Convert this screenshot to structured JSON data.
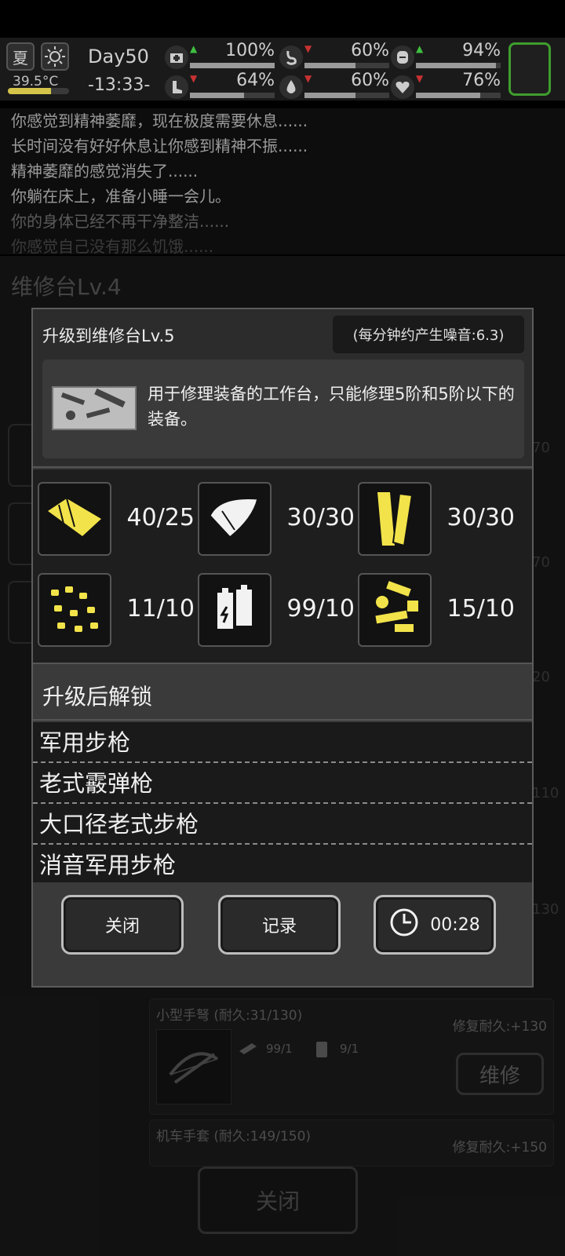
{
  "status": {
    "season_label": "夏",
    "temperature": "39.5°C",
    "temperature_level": 0.7,
    "day": "Day50",
    "time": "-13:33-",
    "stats": [
      {
        "name": "health",
        "icon": "medkit-icon",
        "value": "100%",
        "trend": "up",
        "level": 1.0
      },
      {
        "name": "stomach",
        "icon": "stomach-icon",
        "value": "60%",
        "trend": "down",
        "level": 0.6
      },
      {
        "name": "mood",
        "icon": "face-icon",
        "value": "94%",
        "trend": "up",
        "level": 0.94
      },
      {
        "name": "stamina",
        "icon": "boot-icon",
        "value": "64%",
        "trend": "down",
        "level": 0.64
      },
      {
        "name": "thirst",
        "icon": "water-drop-icon",
        "value": "60%",
        "trend": "down",
        "level": 0.6
      },
      {
        "name": "heart",
        "icon": "heart-icon",
        "value": "76%",
        "trend": "down",
        "level": 0.76
      }
    ],
    "colors": {
      "trend_up": "#3fbf3f",
      "trend_down": "#c83232",
      "highlight": "#3f9e2e",
      "material_yellow": "#f2e34a"
    }
  },
  "log": [
    "你感觉到精神萎靡，现在极度需要休息......",
    "长时间没有好好休息让你感到精神不振......",
    "精神萎靡的感觉消失了......",
    "你躺在床上，准备小睡一会儿。",
    "你的身体已经不再干净整洁......",
    "你感觉自己没有那么饥饿......"
  ],
  "bench": {
    "title": "维修台Lv.4",
    "side_numbers": [
      "70",
      "70",
      "20",
      "110",
      "130"
    ],
    "items": [
      {
        "name": "小型手弩 (耐久:31/130)",
        "fix": "修复耐久:+130",
        "req1_icon": "metal-plate-icon",
        "req1": "99/1",
        "req2_icon": "canister-icon",
        "req2": "9/1",
        "repair_label": "维修"
      },
      {
        "name": "机车手套 (耐久:149/150)",
        "fix": "修复耐久:+150"
      }
    ],
    "close_label": "关闭"
  },
  "modal": {
    "title": "升级到维修台Lv.5",
    "noise": "(每分钟约产生噪音:6.3)",
    "description": "用于修理装备的工作台，只能修理5阶和5阶以下的装备。",
    "desc_icon": "workbench-tools-icon",
    "materials": [
      {
        "icon": "cloth-icon",
        "count": "40/25"
      },
      {
        "icon": "sheet-metal-icon",
        "count": "30/30"
      },
      {
        "icon": "wood-planks-icon",
        "count": "30/30"
      },
      {
        "icon": "screws-icon",
        "count": "11/10"
      },
      {
        "icon": "battery-icon",
        "count": "99/10"
      },
      {
        "icon": "mechanical-parts-icon",
        "count": "15/10"
      }
    ],
    "unlock_title": "升级后解锁",
    "unlocks": [
      "军用步枪",
      "老式霰弹枪",
      "大口径老式步枪",
      "消音军用步枪"
    ],
    "buttons": {
      "close": "关闭",
      "record": "记录",
      "timer": "00:28"
    }
  }
}
